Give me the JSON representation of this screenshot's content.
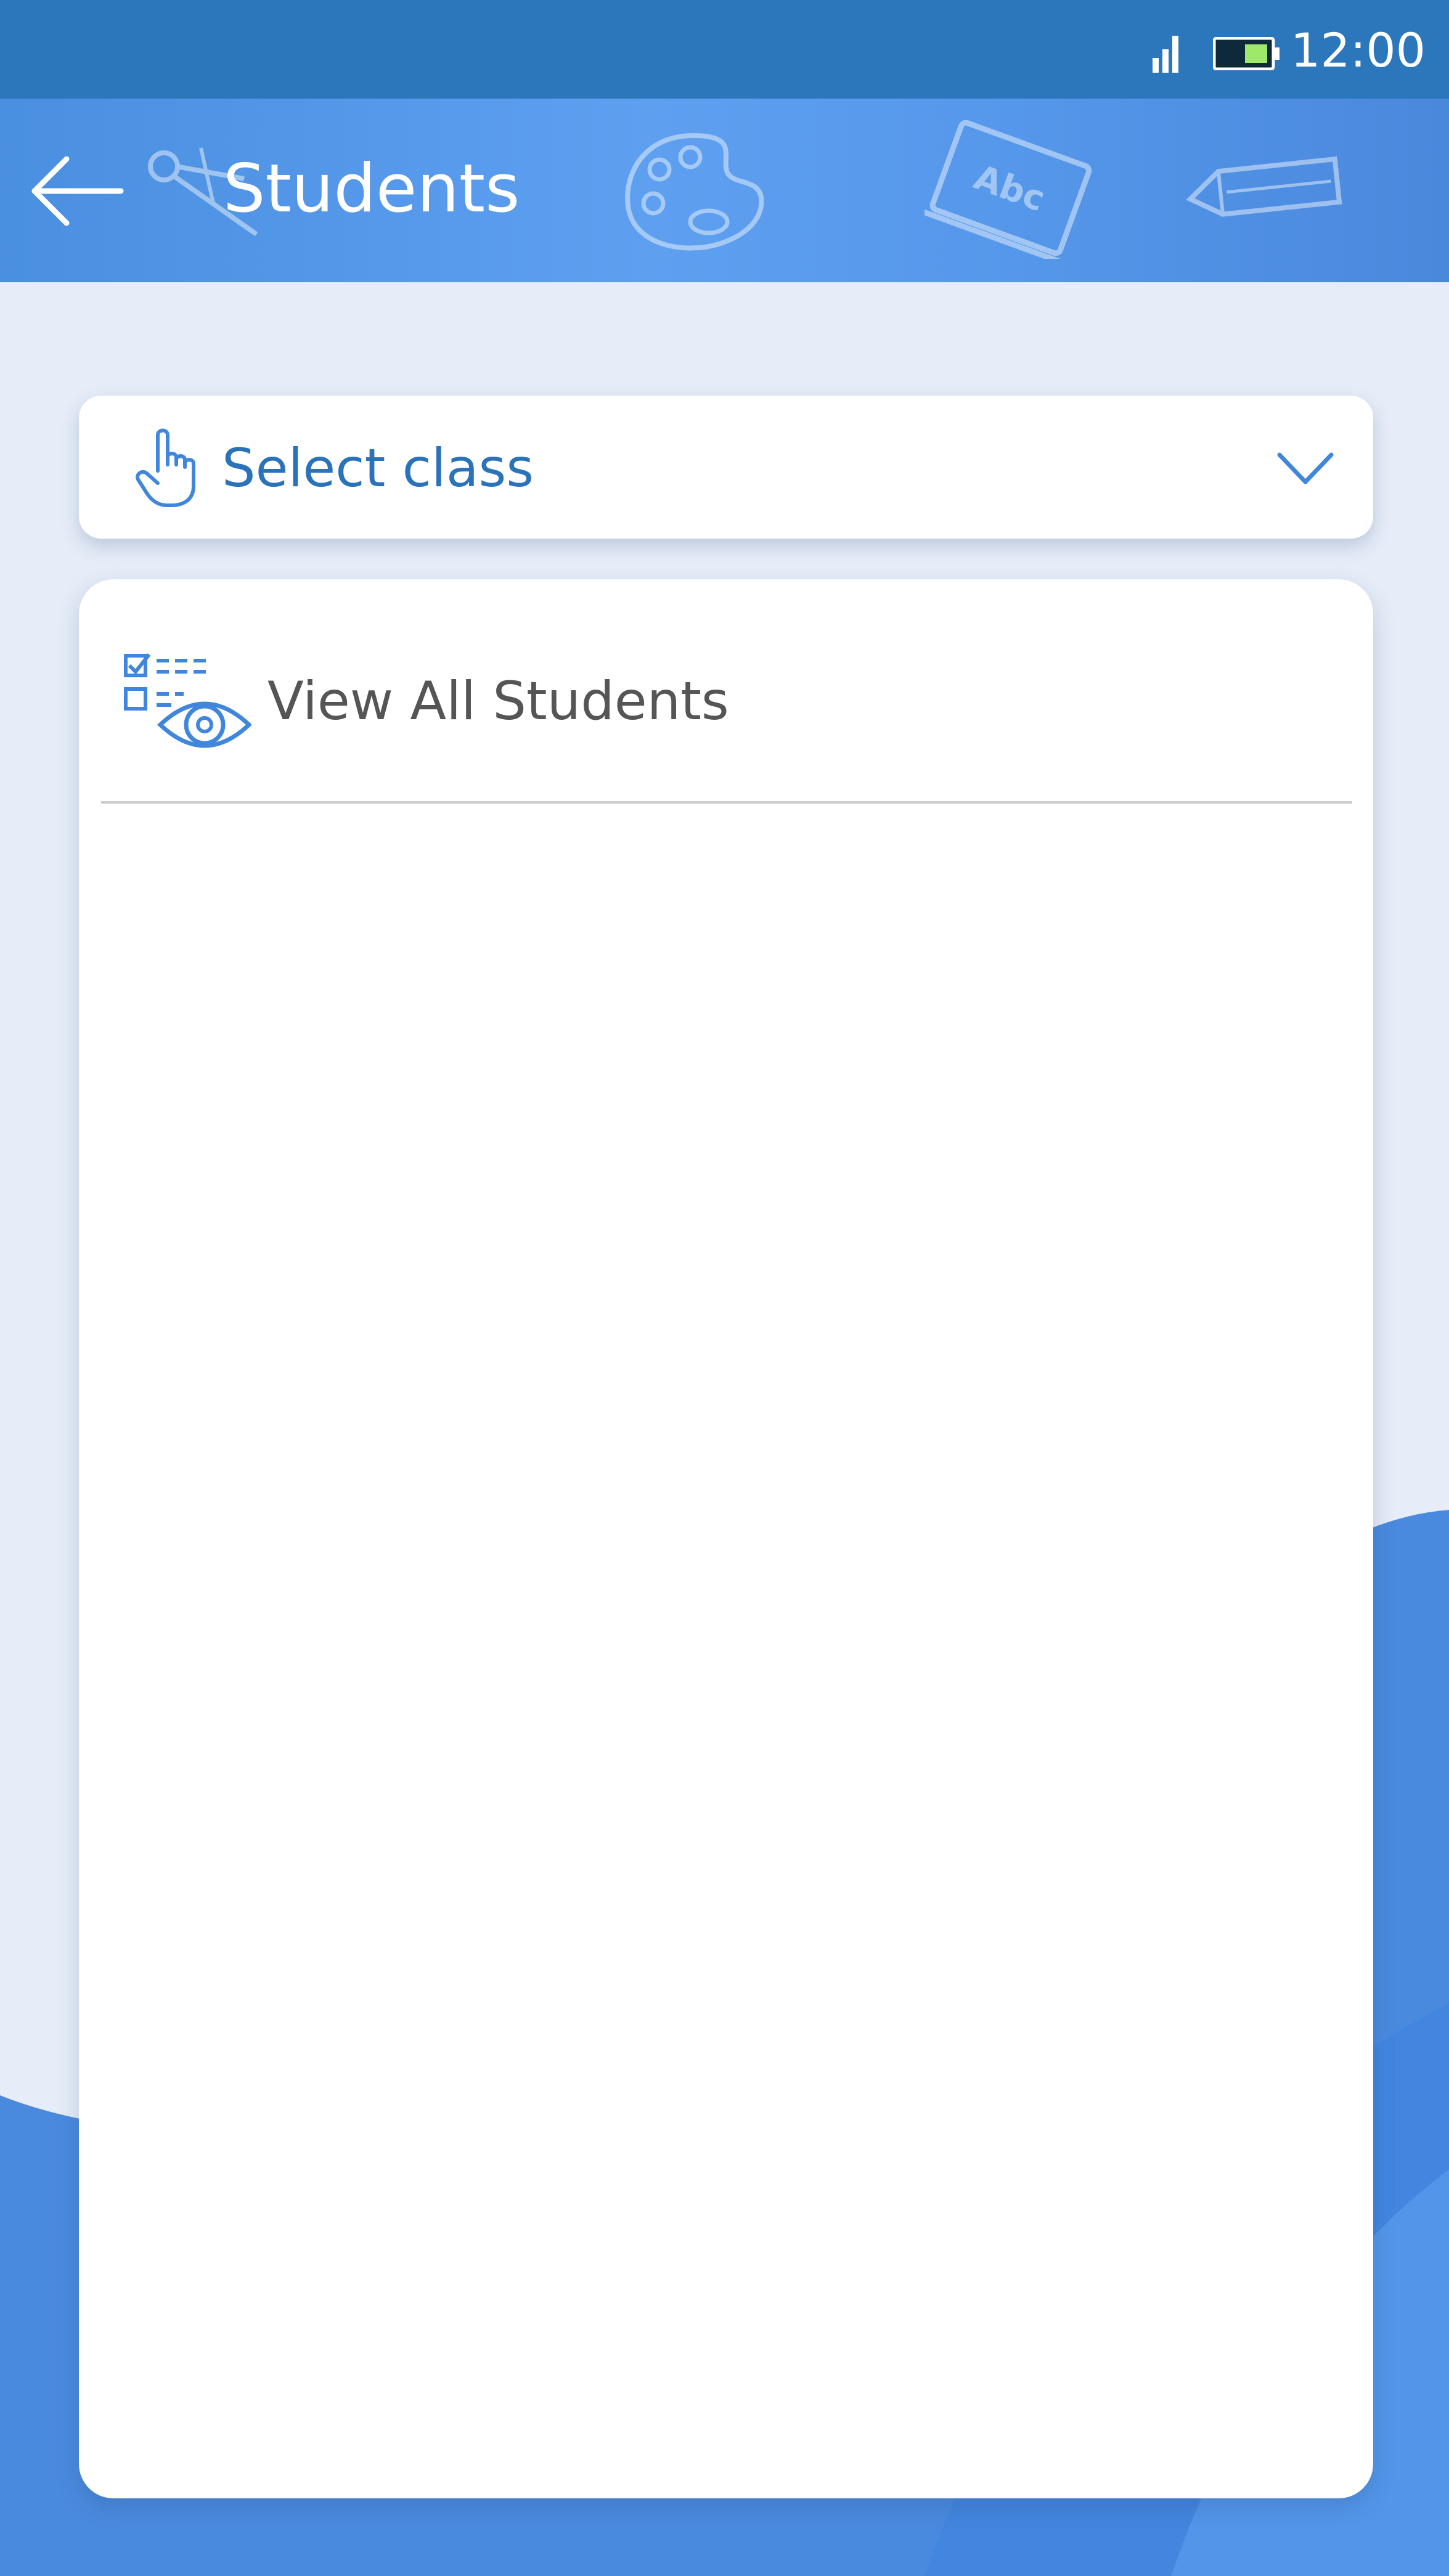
{
  "status_bar": {
    "time": "12:00",
    "icons": [
      "signal-icon",
      "battery-icon"
    ]
  },
  "app_bar": {
    "title": "Students",
    "back_icon": "back-arrow-icon",
    "decorations": [
      "compass-icon",
      "palette-icon",
      "chalkboard-icon",
      "pencil-icon"
    ],
    "chalkboard_text": "Abc"
  },
  "class_select": {
    "label": "Select class",
    "icon": "pointing-hand-icon",
    "chevron": "chevron-down-icon"
  },
  "list": {
    "items": [
      {
        "label": "View All Students",
        "icon": "checklist-eye-icon"
      }
    ]
  },
  "colors": {
    "status_bar": "#2c77bc",
    "app_bar": "#5597ea",
    "accent": "#2a72b9",
    "icon_blue": "#3f86dc",
    "background": "#e6edf8",
    "wave": "#4a8ade"
  }
}
